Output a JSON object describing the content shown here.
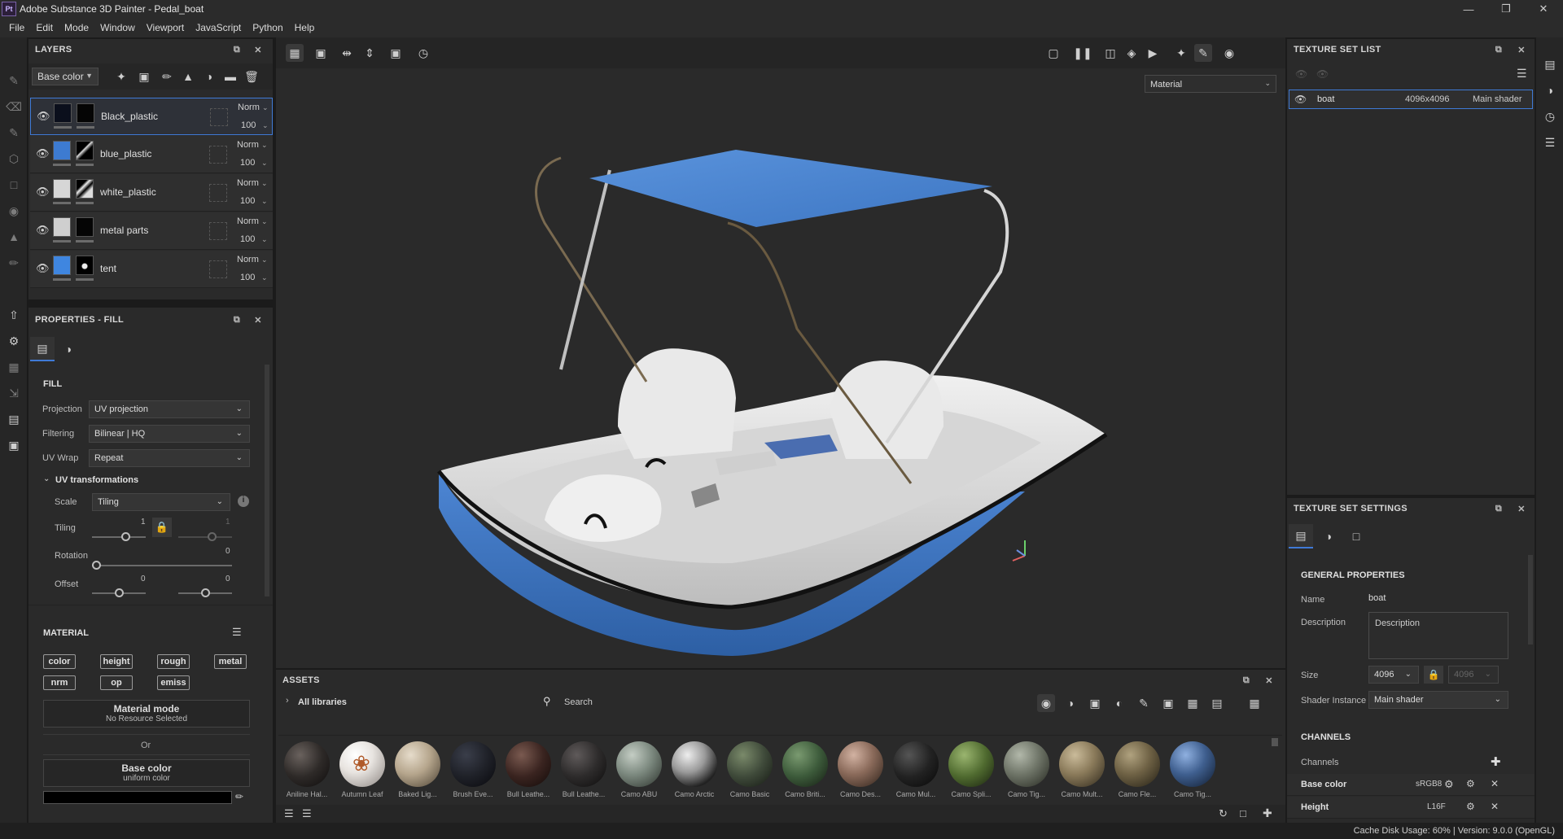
{
  "window": {
    "title": "Adobe Substance 3D Painter - Pedal_boat",
    "logo": "Pt"
  },
  "menu": [
    "File",
    "Edit",
    "Mode",
    "Window",
    "Viewport",
    "JavaScript",
    "Python",
    "Help"
  ],
  "layers_panel": {
    "title": "LAYERS",
    "channel_select": "Base color",
    "layers": [
      {
        "name": "Black_plastic",
        "blend": "Norm",
        "opacity": "100",
        "color": "#0b0f1c",
        "selected": true
      },
      {
        "name": "blue_plastic",
        "blend": "Norm",
        "opacity": "100",
        "color": "#3d7bd1",
        "selected": false
      },
      {
        "name": "white_plastic",
        "blend": "Norm",
        "opacity": "100",
        "color": "#d6d6d6",
        "selected": false
      },
      {
        "name": "metal parts",
        "blend": "Norm",
        "opacity": "100",
        "color": "#cfcfcf",
        "selected": false
      },
      {
        "name": "tent",
        "blend": "Norm",
        "opacity": "100",
        "color": "#3f86e0",
        "selected": false
      }
    ]
  },
  "properties_panel": {
    "title": "PROPERTIES - FILL",
    "fill_section": "FILL",
    "projection_label": "Projection",
    "projection_value": "UV projection",
    "filtering_label": "Filtering",
    "filtering_value": "Bilinear | HQ",
    "uvwrap_label": "UV Wrap",
    "uvwrap_value": "Repeat",
    "uvtrans_label": "UV transformations",
    "scale_label": "Scale",
    "scale_value": "Tiling",
    "tiling_label": "Tiling",
    "tiling_value": "1",
    "tiling_value2": "1",
    "rotation_label": "Rotation",
    "rotation_value": "0",
    "offset_label": "Offset",
    "offset_value": "0",
    "offset_value2": "0",
    "material_section": "MATERIAL",
    "chips": [
      "color",
      "height",
      "rough",
      "metal",
      "nrm",
      "op",
      "emiss"
    ],
    "material_mode_title": "Material mode",
    "material_mode_sub": "No Resource Selected",
    "or_label": "Or",
    "base_color_title": "Base color",
    "base_color_sub": "uniform color"
  },
  "viewport": {
    "material_select": "Material"
  },
  "texture_set_list": {
    "title": "TEXTURE SET LIST",
    "item_name": "boat",
    "item_res": "4096x4096",
    "item_shader": "Main shader"
  },
  "texture_set_settings": {
    "title": "TEXTURE SET SETTINGS",
    "general": "GENERAL PROPERTIES",
    "name_label": "Name",
    "name_value": "boat",
    "desc_label": "Description",
    "desc_placeholder": "Description",
    "size_label": "Size",
    "size_value": "4096",
    "size_value2": "4096",
    "shader_label": "Shader Instance",
    "shader_value": "Main shader",
    "channels_section": "CHANNELS",
    "channels_label": "Channels",
    "channel_rows": [
      {
        "name": "Base color",
        "format": "sRGB8"
      },
      {
        "name": "Height",
        "format": "L16F"
      }
    ]
  },
  "assets": {
    "title": "ASSETS",
    "library": "All libraries",
    "search_placeholder": "Search",
    "items": [
      {
        "label": "Aniline Hal...",
        "color": "#2e2a28"
      },
      {
        "label": "Autumn Leaf",
        "color": "#e8e4e0"
      },
      {
        "label": "Baked Lig...",
        "color": "#b5a58c"
      },
      {
        "label": "Brush Eve...",
        "color": "#1f2128"
      },
      {
        "label": "Bull Leathe...",
        "color": "#3a2420"
      },
      {
        "label": "Bull Leathe...",
        "color": "#2d2b2b"
      },
      {
        "label": "Camo ABU",
        "color": "#7d8a80"
      },
      {
        "label": "Camo Arctic",
        "color": "#9a9a9a"
      },
      {
        "label": "Camo Basic",
        "color": "#3f4a3a"
      },
      {
        "label": "Camo Briti...",
        "color": "#3c5a3a"
      },
      {
        "label": "Camo Des...",
        "color": "#8a6a5a"
      },
      {
        "label": "Camo Mul...",
        "color": "#222"
      },
      {
        "label": "Camo Spli...",
        "color": "#4f6a2f"
      },
      {
        "label": "Camo Tig...",
        "color": "#6f7568"
      },
      {
        "label": "Camo Mult...",
        "color": "#8a7a5a"
      },
      {
        "label": "Camo Fle...",
        "color": "#6f6245"
      },
      {
        "label": "Camo Tig...",
        "color": "#3f5f8f"
      }
    ]
  },
  "status": {
    "text": "Cache Disk Usage:   60% | Version: 9.0.0 (OpenGL)"
  }
}
